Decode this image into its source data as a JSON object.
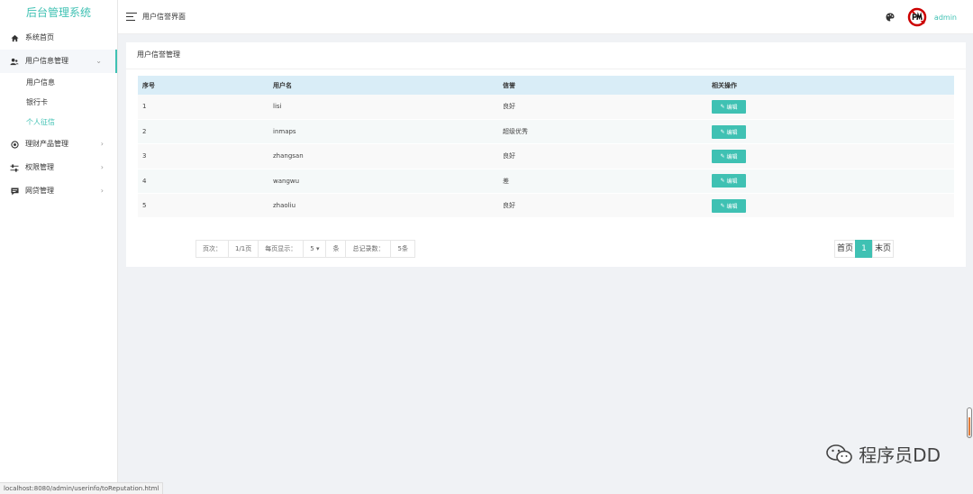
{
  "sidebar": {
    "brand": "后台管理系统",
    "items": [
      {
        "label": "系统首页"
      },
      {
        "label": "用户信息管理",
        "open": true,
        "children": [
          {
            "label": "用户信息"
          },
          {
            "label": "银行卡"
          },
          {
            "label": "个人征信",
            "active": true
          }
        ]
      },
      {
        "label": "理财产品管理"
      },
      {
        "label": "权限管理"
      },
      {
        "label": "网贷管理"
      }
    ]
  },
  "header": {
    "title": "用户信誉界面",
    "user": "admin"
  },
  "panel": {
    "title": "用户信誉管理",
    "table": {
      "headers": [
        "序号",
        "用户名",
        "信誉",
        "相关操作"
      ],
      "rows": [
        {
          "id": "1",
          "username": "lisi",
          "reputation": "良好"
        },
        {
          "id": "2",
          "username": "inmaps",
          "reputation": "超级优秀"
        },
        {
          "id": "3",
          "username": "zhangsan",
          "reputation": "良好"
        },
        {
          "id": "4",
          "username": "wangwu",
          "reputation": "差"
        },
        {
          "id": "5",
          "username": "zhaoliu",
          "reputation": "良好"
        }
      ],
      "edit_label": "编辑"
    },
    "pager": {
      "page_label": "页次：",
      "page_value": "1/1页",
      "per_page_label": "每页显示：",
      "per_page_value": "5",
      "per_page_unit": "条",
      "total_label": "总记录数：",
      "total_value": "5条",
      "first": "首页",
      "current": "1",
      "last": "末页"
    }
  },
  "statusbar": "localhost:8080/admin/userinfo/toReputation.html",
  "watermark": "程序员DD",
  "colors": {
    "accent": "#3fc1b3",
    "table_header": "#d9edf7",
    "background": "#f0f2f5"
  }
}
